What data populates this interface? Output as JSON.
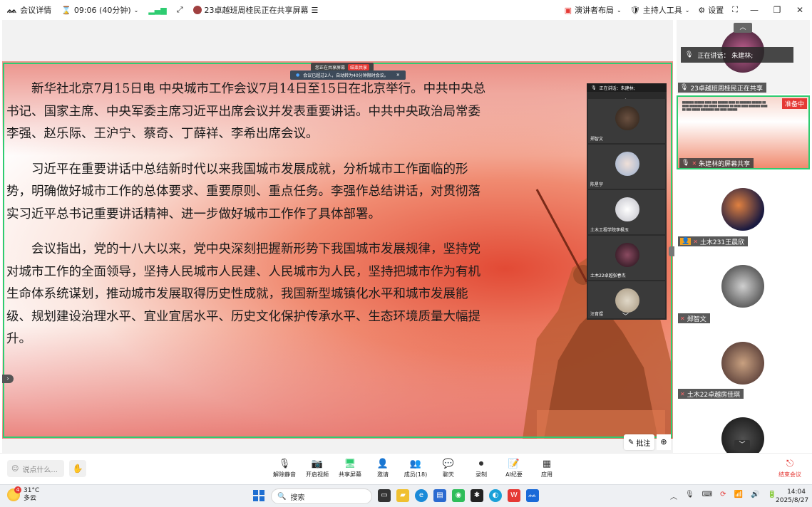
{
  "titlebar": {
    "meeting_details": "会议详情",
    "timer": "09:06 (40分钟)",
    "share_status": "23卓越班周桂民正在共享屏幕",
    "layout": "演讲者布局",
    "host_tools": "主持人工具",
    "settings": "设置"
  },
  "stage": {
    "share_pill": "您正在共享屏幕",
    "end_share": "结束共享",
    "notice": "会议已超过2人，自动转为40分钟限时会议。",
    "paragraphs": [
      "新华社北京7月15日电  中央城市工作会议7月14日至15日在北京举行。中共中央总书记、国家主席、中央军委主席习近平出席会议并发表重要讲话。中共中央政治局常委李强、赵乐际、王沪宁、蔡奇、丁薛祥、李希出席会议。",
      "习近平在重要讲话中总结新时代以来我国城市发展成就，分析城市工作面临的形势，明确做好城市工作的总体要求、重要原则、重点任务。李强作总结讲话，对贯彻落实习近平总书记重要讲话精神、进一步做好城市工作作了具体部署。",
      "会议指出，党的十八大以来，党中央深刻把握新形势下我国城市发展规律，坚持党对城市工作的全面领导，坚持人民城市人民建、人民城市为人民，坚持把城市作为有机生命体系统谋划，推动城市发展取得历史性成就，我国新型城镇化水平和城市发展能级、规划建设治理水平、宜业宜居水平、历史文化保护传承水平、生态环境质量大幅提升。"
    ],
    "overlay_header": "正在讲话：朱建林;",
    "overlay_names": [
      "郑智文",
      "陈星宇",
      "土木工程学院李枫玉",
      "土木22卓越张春杰",
      "汪育煜"
    ],
    "annotate": "批注"
  },
  "panel": {
    "speaking": "正在讲话：  朱建林;",
    "tiles": [
      {
        "name": "23卓越班周桂民正在共享"
      },
      {
        "name": "朱建林的屏幕共享"
      },
      {
        "name": "土木231王晨欣"
      },
      {
        "name": "郑智文"
      },
      {
        "name": "土木22卓越房佳琪"
      }
    ],
    "ready_badge": "准备中"
  },
  "toolbar": {
    "chat_placeholder": "说点什么...",
    "tools": [
      {
        "label": "解除静音",
        "icon": "mic-off-icon",
        "glyph": "🎙"
      },
      {
        "label": "开启视频",
        "icon": "camera-off-icon",
        "glyph": "📷"
      },
      {
        "label": "共享屏幕",
        "icon": "share-screen-icon",
        "glyph": "🖥"
      },
      {
        "label": "邀请",
        "icon": "invite-icon",
        "glyph": "👤"
      },
      {
        "label": "成员(18)",
        "icon": "members-icon",
        "glyph": "👥"
      },
      {
        "label": "聊天",
        "icon": "chat-icon",
        "glyph": "💬"
      },
      {
        "label": "录制",
        "icon": "record-icon",
        "glyph": "⏺"
      },
      {
        "label": "AI纪要",
        "icon": "ai-notes-icon",
        "glyph": "📝"
      },
      {
        "label": "应用",
        "icon": "apps-icon",
        "glyph": "▦"
      }
    ],
    "leave": "结束会议"
  },
  "taskbar": {
    "weather_badge": "4",
    "temperature": "31°C",
    "condition": "多云",
    "search": "搜索",
    "time": "14:04",
    "date": "2025/8/27"
  },
  "colors": {
    "share_border": "#2ecc71",
    "accent_red": "#e53935",
    "toolbar_text": "#222222"
  }
}
